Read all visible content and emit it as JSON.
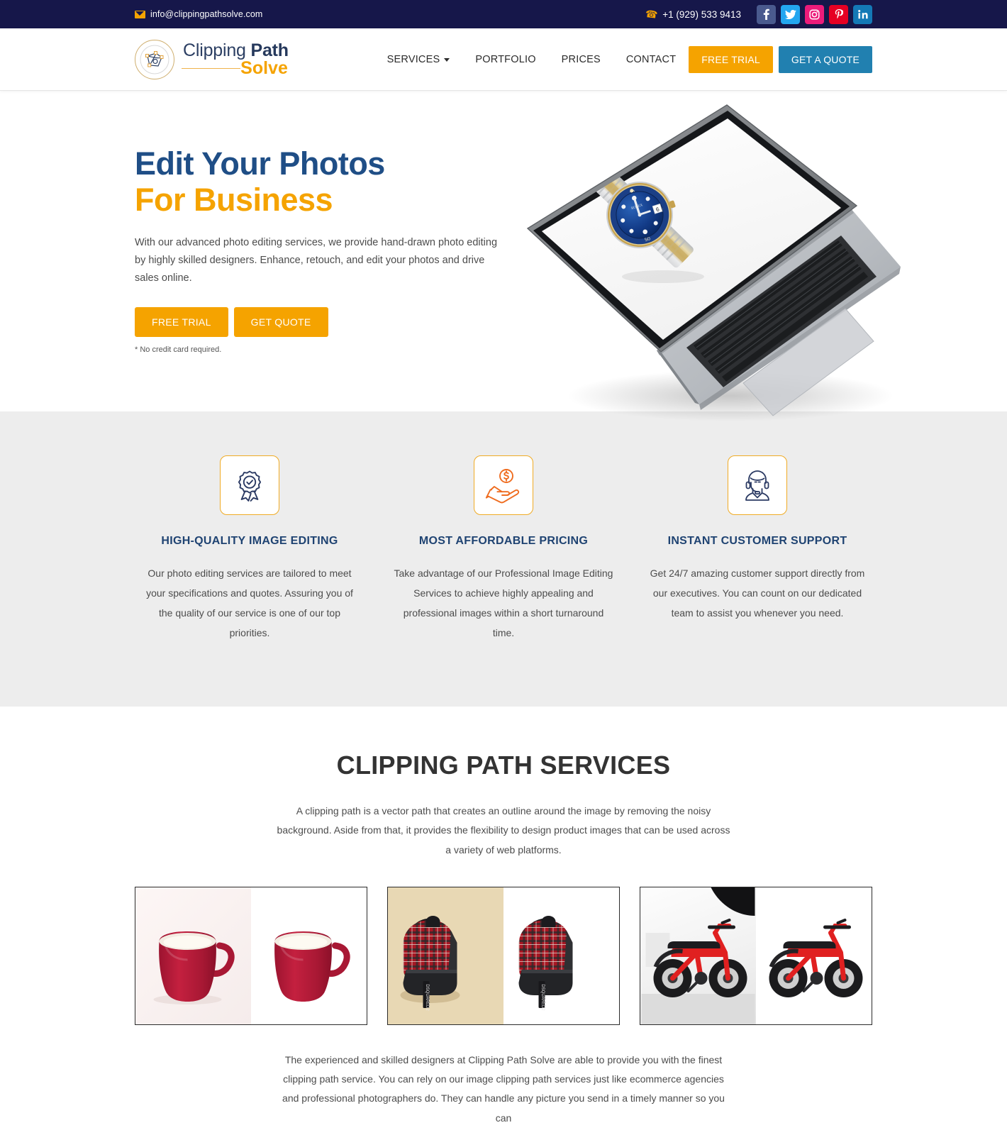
{
  "topbar": {
    "email": "info@clippingpathsolve.com",
    "email_icon": "envelope-icon",
    "phone": "+1 (929) 533 9413",
    "phone_icon": "phone-icon",
    "socials": [
      {
        "name": "facebook",
        "label": "f",
        "color": "#4a5a8e"
      },
      {
        "name": "twitter",
        "label": "t",
        "color": "#23a6f0"
      },
      {
        "name": "instagram",
        "label": "o",
        "color": "#ec1b7a"
      },
      {
        "name": "pinterest",
        "label": "P",
        "color": "#e60023"
      },
      {
        "name": "linkedin",
        "label": "in",
        "color": "#1479b6"
      }
    ],
    "bg_color": "#16174a"
  },
  "header": {
    "logo": {
      "line1_light": "Clipping ",
      "line1_bold": "Path",
      "line2": "Solve"
    },
    "nav": [
      {
        "label": "SERVICES",
        "has_caret": true
      },
      {
        "label": "PORTFOLIO",
        "has_caret": false
      },
      {
        "label": "PRICES",
        "has_caret": false
      },
      {
        "label": "CONTACT",
        "has_caret": false
      }
    ],
    "free_trial": "FREE TRIAL",
    "get_a_quote": "GET A QUOTE",
    "accent_orange": "#f5a300",
    "accent_blue": "#2180b0"
  },
  "hero": {
    "heading_line1": "Edit Your Photos",
    "heading_line2": "For Business",
    "paragraph": "With our advanced photo editing services, we provide hand-drawn photo editing by highly skilled designers. Enhance, retouch, and edit your photos and drive sales online.",
    "btn_free_trial": "FREE TRIAL",
    "btn_get_quote": "GET QUOTE",
    "note": "* No credit card required.",
    "image_alt": "laptop-with-watch-image"
  },
  "features": {
    "bg_color": "#ededed",
    "items": [
      {
        "icon": "award-badge-icon",
        "title": "HIGH-QUALITY IMAGE EDITING",
        "text": "Our photo editing services are tailored to meet your specifications and quotes. Assuring you of the quality of our service is one of our top priorities."
      },
      {
        "icon": "hand-with-coin-icon",
        "title": "MOST AFFORDABLE PRICING",
        "text": "Take advantage of our Professional Image Editing Services to achieve highly appealing and professional images within a short turnaround time."
      },
      {
        "icon": "headset-support-agent-icon",
        "title": "INSTANT CUSTOMER SUPPORT",
        "text": "Get 24/7 amazing customer support directly from our executives. You can count on our dedicated team to assist you whenever you need."
      }
    ]
  },
  "services": {
    "title": "CLIPPING PATH SERVICES",
    "intro": "A clipping path is a vector path that creates an outline around the image by removing the noisy background. Aside from that, it provides the flexibility to design product images that can be used across a variety of web platforms.",
    "gallery": [
      {
        "name": "red-mug-before-after",
        "before_bg": "#f7efee",
        "after_bg": "#ffffff"
      },
      {
        "name": "plaid-backpack-before-after",
        "before_bg": "#e8d8b4",
        "after_bg": "#ffffff"
      },
      {
        "name": "red-ebike-before-after",
        "before_bg": "#f0f0f0",
        "after_bg": "#ffffff"
      }
    ],
    "outro": "The experienced and skilled designers at Clipping Path Solve are able to provide you with the finest clipping path service. You can rely on our image clipping path services just like ecommerce agencies and professional photographers do. They can handle any picture you send in a timely manner so you can"
  }
}
